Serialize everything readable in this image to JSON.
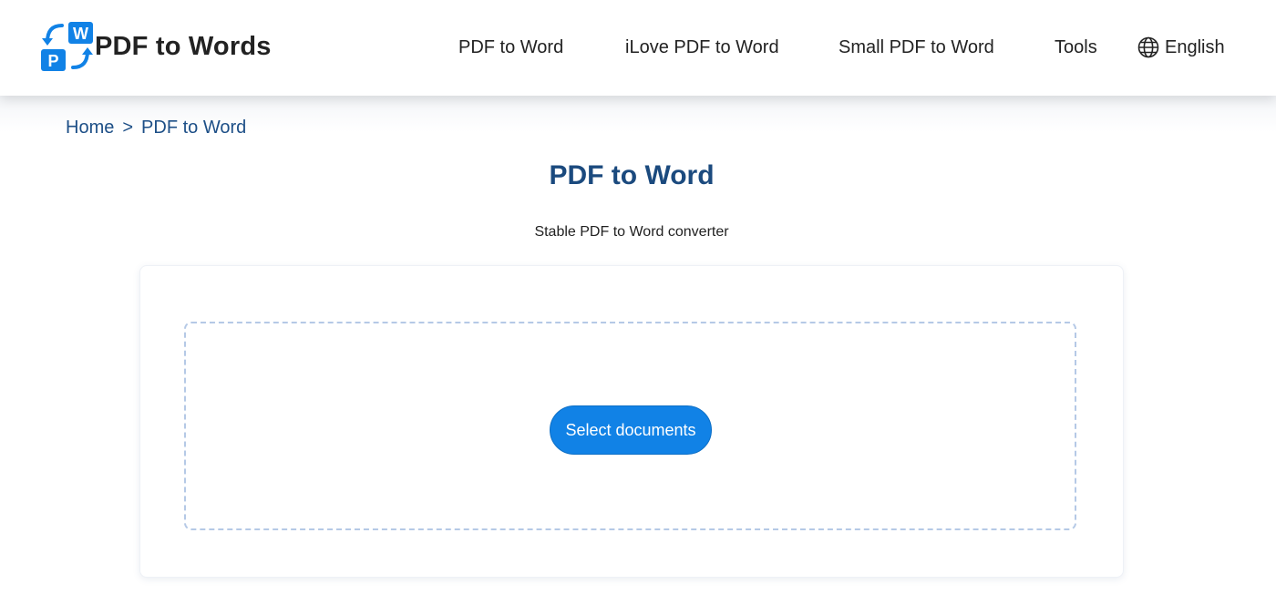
{
  "header": {
    "logo_text": "PDF to Words",
    "logo_letters": {
      "w": "W",
      "p": "P"
    },
    "nav": [
      {
        "label": "PDF to Word"
      },
      {
        "label": "iLove PDF to Word"
      },
      {
        "label": "Small PDF to Word"
      },
      {
        "label": "Tools"
      }
    ],
    "language": "English",
    "icons": {
      "logo": "convert-arrows-logo",
      "language": "globe-icon"
    }
  },
  "breadcrumb": {
    "home": "Home",
    "separator": ">",
    "current": "PDF to Word"
  },
  "main": {
    "title": "PDF to Word",
    "subtitle": "Stable PDF to Word converter",
    "upload": {
      "button_label": "Select documents"
    }
  },
  "colors": {
    "accent": "#1182e6",
    "title": "#1b4a7e",
    "link": "#1d4f87",
    "dropzone_border": "#b5c9e6"
  }
}
